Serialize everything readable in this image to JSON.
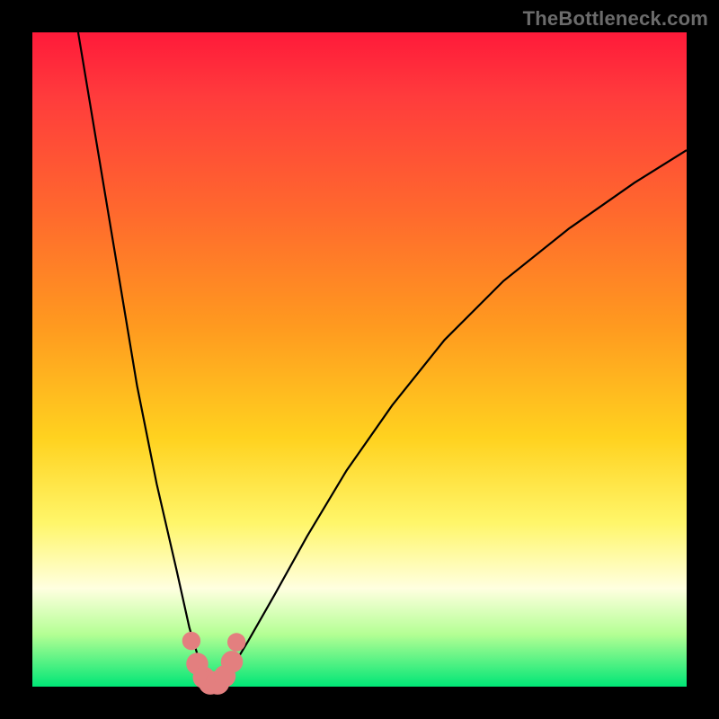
{
  "watermark": "TheBottleneck.com",
  "chart_data": {
    "type": "line",
    "title": "",
    "xlabel": "",
    "ylabel": "",
    "xlim": [
      0,
      100
    ],
    "ylim": [
      0,
      100
    ],
    "background_gradient_top": "#ff1a3a",
    "background_gradient_bottom": "#00e676",
    "series": [
      {
        "name": "left-branch",
        "stroke": "#000000",
        "x": [
          7,
          10,
          13,
          16,
          19,
          22,
          24,
          25.5,
          26.5,
          27.0
        ],
        "y": [
          100,
          82,
          64,
          46,
          31,
          18,
          9,
          4,
          1.5,
          0.4
        ]
      },
      {
        "name": "right-branch",
        "stroke": "#000000",
        "x": [
          28.5,
          30,
          33,
          37,
          42,
          48,
          55,
          63,
          72,
          82,
          92,
          100
        ],
        "y": [
          0.4,
          2,
          7,
          14,
          23,
          33,
          43,
          53,
          62,
          70,
          77,
          82
        ]
      }
    ],
    "markers": [
      {
        "x": 24.3,
        "y": 7.0,
        "r": 1.0,
        "fill": "#e37f7f"
      },
      {
        "x": 25.2,
        "y": 3.5,
        "r": 1.2,
        "fill": "#e37f7f"
      },
      {
        "x": 26.2,
        "y": 1.4,
        "r": 1.2,
        "fill": "#e37f7f"
      },
      {
        "x": 27.2,
        "y": 0.6,
        "r": 1.3,
        "fill": "#e37f7f"
      },
      {
        "x": 28.3,
        "y": 0.6,
        "r": 1.3,
        "fill": "#e37f7f"
      },
      {
        "x": 29.4,
        "y": 1.6,
        "r": 1.2,
        "fill": "#e37f7f"
      },
      {
        "x": 30.5,
        "y": 3.8,
        "r": 1.2,
        "fill": "#e37f7f"
      },
      {
        "x": 31.2,
        "y": 6.8,
        "r": 1.0,
        "fill": "#e37f7f"
      }
    ]
  }
}
